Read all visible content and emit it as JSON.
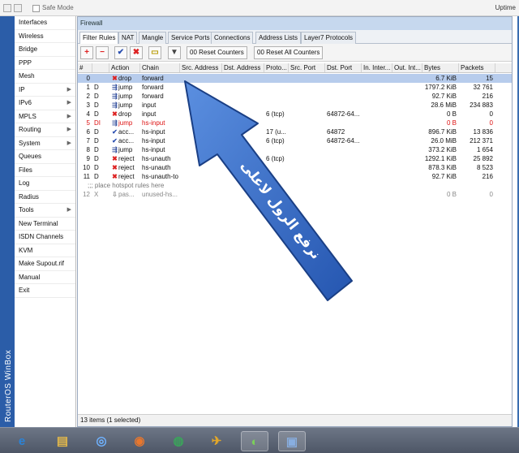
{
  "titlebar": {
    "safe_mode": "Safe Mode",
    "right_text": "Uptime"
  },
  "brand": {
    "vertical_label": "RouterOS WinBox"
  },
  "menu": [
    {
      "label": "Interfaces",
      "arrow": ""
    },
    {
      "label": "Wireless",
      "arrow": ""
    },
    {
      "label": "Bridge",
      "arrow": ""
    },
    {
      "label": "PPP",
      "arrow": ""
    },
    {
      "label": "Mesh",
      "arrow": ""
    },
    {
      "label": "IP",
      "arrow": "▶"
    },
    {
      "label": "IPv6",
      "arrow": "▶"
    },
    {
      "label": "MPLS",
      "arrow": "▶"
    },
    {
      "label": "Routing",
      "arrow": "▶"
    },
    {
      "label": "System",
      "arrow": "▶"
    },
    {
      "label": "Queues",
      "arrow": ""
    },
    {
      "label": "Files",
      "arrow": ""
    },
    {
      "label": "Log",
      "arrow": ""
    },
    {
      "label": "Radius",
      "arrow": ""
    },
    {
      "label": "Tools",
      "arrow": "▶"
    },
    {
      "label": "New Terminal",
      "arrow": ""
    },
    {
      "label": "ISDN Channels",
      "arrow": ""
    },
    {
      "label": "KVM",
      "arrow": ""
    },
    {
      "label": "Make Supout.rif",
      "arrow": ""
    },
    {
      "label": "Manual",
      "arrow": ""
    },
    {
      "label": "Exit",
      "arrow": ""
    }
  ],
  "window": {
    "title": "Firewall",
    "tabs": [
      "Filter Rules",
      "NAT",
      "Mangle",
      "Service Ports",
      "Connections",
      "Address Lists",
      "Layer7 Protocols"
    ],
    "active_tab": 0,
    "toolbar": {
      "add": "+",
      "remove": "−",
      "enable": "✔",
      "disable": "✖",
      "comment": "▭",
      "filter": "▼",
      "reset_counters": "00 Reset Counters",
      "reset_all": "00 Reset All Counters"
    },
    "columns": [
      "#",
      "",
      "Action",
      "Chain",
      "Src. Address",
      "Dst. Address",
      "Proto...",
      "Src. Port",
      "Dst. Port",
      "In. Inter...",
      "Out. Int...",
      "Bytes",
      "Packets"
    ],
    "rows": [
      {
        "num": "0",
        "flag": "",
        "act_icon": "✖",
        "act_cls": "ico-drop",
        "action": "drop",
        "chain": "forward",
        "proto": "",
        "dport": "",
        "bytes": "6.7 KiB",
        "packets": "15",
        "state": "sel"
      },
      {
        "num": "1",
        "flag": "D",
        "act_icon": "⇶",
        "act_cls": "ico-jump",
        "action": "jump",
        "chain": "forward",
        "proto": "",
        "dport": "",
        "bytes": "1797.2 KiB",
        "packets": "32 761",
        "state": ""
      },
      {
        "num": "2",
        "flag": "D",
        "act_icon": "⇶",
        "act_cls": "ico-jump",
        "action": "jump",
        "chain": "forward",
        "proto": "",
        "dport": "",
        "bytes": "92.7 KiB",
        "packets": "216",
        "state": ""
      },
      {
        "num": "3",
        "flag": "D",
        "act_icon": "⇶",
        "act_cls": "ico-jump",
        "action": "jump",
        "chain": "input",
        "proto": "",
        "dport": "",
        "bytes": "28.6 MiB",
        "packets": "234 883",
        "state": ""
      },
      {
        "num": "4",
        "flag": "D",
        "act_icon": "✖",
        "act_cls": "ico-drop",
        "action": "drop",
        "chain": "input",
        "proto": "6 (tcp)",
        "dport": "64872-64...",
        "bytes": "0 B",
        "packets": "0",
        "state": ""
      },
      {
        "num": "5",
        "flag": "DI",
        "act_icon": "⇶",
        "act_cls": "ico-jump",
        "action": "jump",
        "chain": "hs-input",
        "proto": "",
        "dport": "",
        "bytes": "0 B",
        "packets": "0",
        "state": "red"
      },
      {
        "num": "6",
        "flag": "D",
        "act_icon": "✔",
        "act_cls": "ico-acc",
        "action": "acc...",
        "chain": "hs-input",
        "proto": "17 (u...",
        "dport": "64872",
        "bytes": "896.7 KiB",
        "packets": "13 836",
        "state": ""
      },
      {
        "num": "7",
        "flag": "D",
        "act_icon": "✔",
        "act_cls": "ico-acc",
        "action": "acc...",
        "chain": "hs-input",
        "proto": "6 (tcp)",
        "dport": "64872-64...",
        "bytes": "26.0 MiB",
        "packets": "212 371",
        "state": ""
      },
      {
        "num": "8",
        "flag": "D",
        "act_icon": "⇶",
        "act_cls": "ico-jump",
        "action": "jump",
        "chain": "hs-input",
        "proto": "",
        "dport": "",
        "bytes": "373.2 KiB",
        "packets": "1 654",
        "state": ""
      },
      {
        "num": "9",
        "flag": "D",
        "act_icon": "✖",
        "act_cls": "ico-reject",
        "action": "reject",
        "chain": "hs-unauth",
        "proto": "6 (tcp)",
        "dport": "",
        "bytes": "1292.1 KiB",
        "packets": "25 892",
        "state": ""
      },
      {
        "num": "10",
        "flag": "D",
        "act_icon": "✖",
        "act_cls": "ico-reject",
        "action": "reject",
        "chain": "hs-unauth",
        "proto": "",
        "dport": "",
        "bytes": "878.3 KiB",
        "packets": "8 523",
        "state": ""
      },
      {
        "num": "11",
        "flag": "D",
        "act_icon": "✖",
        "act_cls": "ico-reject",
        "action": "reject",
        "chain": "hs-unauth-to",
        "proto": "",
        "dport": "",
        "bytes": "92.7 KiB",
        "packets": "216",
        "state": ""
      }
    ],
    "comment_row": ";;; place hotspot rules here",
    "last_row": {
      "num": "12",
      "flag": "X",
      "act_icon": "⇩",
      "act_cls": "ico-pass",
      "action": "pas...",
      "chain": "unused-hs...",
      "bytes": "0 B",
      "packets": "0"
    },
    "status": "13 items (1 selected)"
  },
  "annotation": {
    "text": "نرفع الرول لاعلى",
    "arrow_color": "#2f68c4"
  },
  "taskbar": [
    "ie-icon",
    "explorer-icon",
    "app-icon",
    "firefox-icon",
    "chrome-icon",
    "ftp-icon",
    "media-icon",
    "winbox-icon"
  ]
}
